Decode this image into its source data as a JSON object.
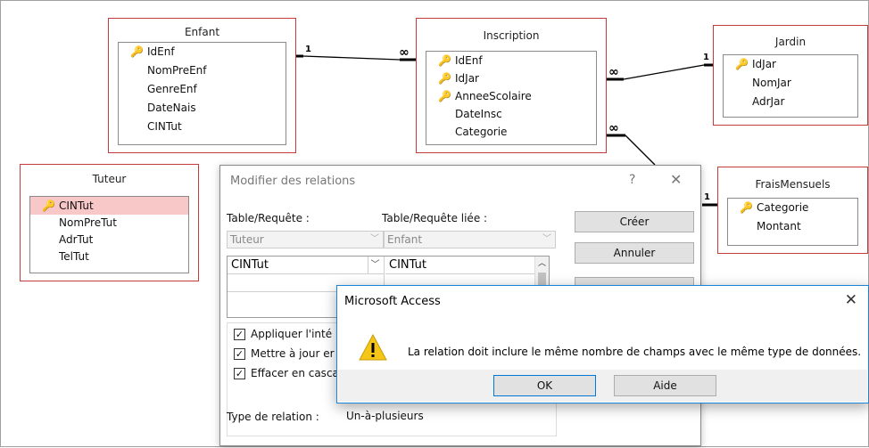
{
  "tables": {
    "enfant": {
      "title": "Enfant",
      "fields": [
        {
          "name": "IdEnf",
          "key": true
        },
        {
          "name": "NomPreEnf",
          "key": false
        },
        {
          "name": "GenreEnf",
          "key": false
        },
        {
          "name": "DateNais",
          "key": false
        },
        {
          "name": "CINTut",
          "key": false
        }
      ]
    },
    "inscription": {
      "title": "Inscription",
      "fields": [
        {
          "name": "IdEnf",
          "key": true
        },
        {
          "name": "IdJar",
          "key": true
        },
        {
          "name": "AnneeScolaire",
          "key": true
        },
        {
          "name": "DateInsc",
          "key": false
        },
        {
          "name": "Categorie",
          "key": false
        }
      ]
    },
    "jardin": {
      "title": "Jardin",
      "fields": [
        {
          "name": "IdJar",
          "key": true
        },
        {
          "name": "NomJar",
          "key": false
        },
        {
          "name": "AdrJar",
          "key": false
        }
      ]
    },
    "tuteur": {
      "title": "Tuteur",
      "fields": [
        {
          "name": "CINTut",
          "key": true,
          "selected": true
        },
        {
          "name": "NomPreTut",
          "key": false
        },
        {
          "name": "AdrTut",
          "key": false
        },
        {
          "name": "TelTut",
          "key": false
        }
      ]
    },
    "frais": {
      "title": "FraisMensuels",
      "fields": [
        {
          "name": "Categorie",
          "key": true
        },
        {
          "name": "Montant",
          "key": false
        }
      ]
    }
  },
  "relations": {
    "one": "1",
    "many": "∞"
  },
  "icons": {
    "key": "key-icon",
    "help": "help-icon",
    "close": "close-icon",
    "warning": "warning-icon",
    "dropdown": "chevron-down-icon"
  },
  "relations_dialog": {
    "title": "Modifier des relations",
    "help_glyph": "?",
    "close_glyph": "✕",
    "table_label": "Table/Requête :",
    "related_label": "Table/Requête liée :",
    "table_value": "Tuteur",
    "related_value": "Enfant",
    "grid": {
      "left_value": "CINTut",
      "right_value": "CINTut"
    },
    "create_button": "Créer",
    "cancel_button": "Annuler",
    "checkboxes": [
      {
        "label": "Appliquer l'inté",
        "checked": true
      },
      {
        "label": "Mettre à jour er",
        "checked": true
      },
      {
        "label": "Effacer en casca",
        "checked": true
      }
    ],
    "relation_type_label": "Type de relation :",
    "relation_type_value": "Un-à-plusieurs"
  },
  "message_box": {
    "title": "Microsoft Access",
    "close_glyph": "✕",
    "message": "La relation doit inclure le même nombre de champs avec le même type de données.",
    "ok_button": "OK",
    "help_button": "Aide"
  },
  "colors": {
    "table_border": "#c43b3b",
    "selected_row": "#f8c7c7",
    "msg_border": "#1883d7",
    "warning": "#f5c518"
  }
}
